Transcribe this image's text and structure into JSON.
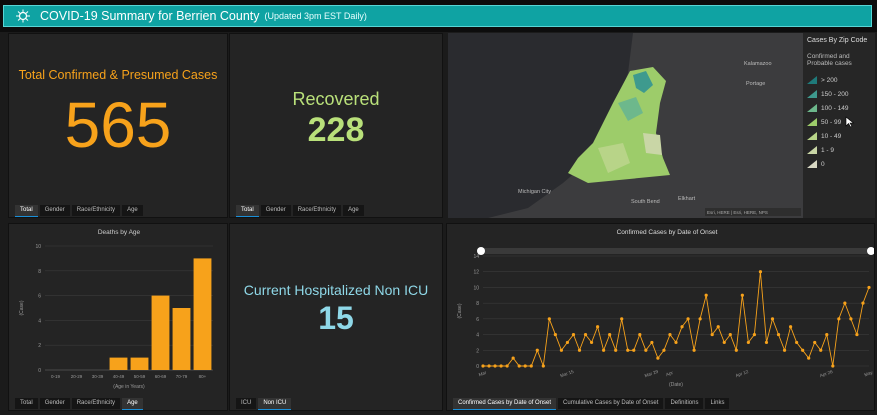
{
  "header": {
    "title": "COVID-19 Summary for Berrien County",
    "updated": "(Updated 3pm EST Daily)",
    "accent": "#0fa3a3"
  },
  "confirmed": {
    "label": "Total Confirmed & Presumed Cases",
    "value": "565",
    "color": "#f7a21b",
    "tabs": [
      "Total",
      "Gender",
      "Race/Ethnicity",
      "Age"
    ]
  },
  "recovered": {
    "label": "Recovered",
    "value": "228",
    "color": "#b9e07a",
    "tabs": [
      "Total",
      "Gender",
      "Race/Ethnicity",
      "Age"
    ]
  },
  "hospital": {
    "label": "Current Hospitalized Non ICU",
    "value": "15",
    "color": "#8fd8e8",
    "tabs": [
      "ICU",
      "Non ICU"
    ]
  },
  "map": {
    "places": [
      "Kalamazoo",
      "Portage",
      "Michigan City",
      "South Bend",
      "Elkhart"
    ],
    "attribution": "Esri, HERE | Esri, HERE, NPS",
    "legend_title": "Cases By Zip Code",
    "legend_sub": "Confirmed and Probable cases",
    "legend": [
      {
        "label": "> 200",
        "color": "#1f7a7a"
      },
      {
        "label": "150 - 200",
        "color": "#3e9a8e"
      },
      {
        "label": "100 - 149",
        "color": "#6db88c"
      },
      {
        "label": "50 - 99",
        "color": "#9dcc6a"
      },
      {
        "label": "10 - 49",
        "color": "#b8d488"
      },
      {
        "label": "1 - 9",
        "color": "#c9d6a6"
      },
      {
        "label": "0",
        "color": "#d8d8c4"
      }
    ]
  },
  "deaths_tabs": [
    "Total",
    "Gender",
    "Race/Ethnicity",
    "Age"
  ],
  "onset_tabs": [
    "Confirmed Cases by Date of Onset",
    "Cumulative Cases by Date of Onset",
    "Definitions",
    "Links"
  ],
  "chart_data": [
    {
      "type": "bar",
      "title": "Deaths by Age",
      "xlabel": "(Age in Years)",
      "ylabel": "(Case)",
      "categories": [
        "0-19",
        "20-29",
        "30-39",
        "40-49",
        "50-59",
        "60-69",
        "70-79",
        "80+"
      ],
      "values": [
        0,
        0,
        0,
        1,
        1,
        6,
        5,
        9
      ],
      "ylim": [
        0,
        10
      ],
      "yticks": [
        0,
        2,
        4,
        6,
        8,
        10
      ],
      "color": "#f7a21b",
      "grid": true
    },
    {
      "type": "line",
      "title": "Confirmed Cases by Date of Onset",
      "xlabel": "(Date)",
      "ylabel": "(Case)",
      "ylim": [
        0,
        14
      ],
      "yticks": [
        0,
        2,
        4,
        6,
        8,
        10,
        12,
        14
      ],
      "xticks": [
        "Mar",
        "Mar 15",
        "Mar 29",
        "Apr",
        "Apr 12",
        "Apr 26",
        "May"
      ],
      "values": [
        0,
        0,
        0,
        0,
        0,
        1,
        0,
        0,
        0,
        2,
        0,
        6,
        4,
        2,
        3,
        4,
        2,
        4,
        3,
        5,
        2,
        4,
        2,
        6,
        2,
        2,
        4,
        2,
        3,
        1,
        2,
        4,
        3,
        5,
        6,
        2,
        6,
        9,
        4,
        5,
        3,
        4,
        2,
        9,
        3,
        4,
        12,
        3,
        6,
        4,
        2,
        5,
        3,
        2,
        1,
        3,
        2,
        4,
        0,
        6,
        8,
        6,
        4,
        8,
        10
      ],
      "color": "#f7a21b",
      "grid": true
    }
  ]
}
